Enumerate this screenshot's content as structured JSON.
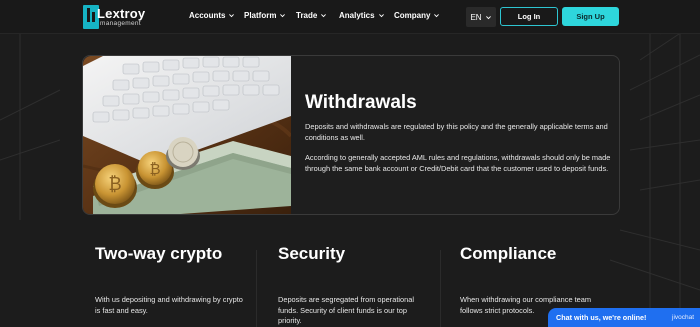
{
  "colors": {
    "accent": "#2ed6dc",
    "background": "#1c1c1c",
    "chat": "#1f6ff0"
  },
  "header": {
    "logo_name": "Lextroy",
    "logo_sub": "management",
    "nav": [
      {
        "label": "Accounts",
        "icon": "chevron-down-icon"
      },
      {
        "label": "Platform",
        "icon": "chevron-down-icon"
      },
      {
        "label": "Trade",
        "icon": "chevron-down-icon"
      },
      {
        "label": "Analytics",
        "icon": "chevron-down-icon"
      },
      {
        "label": "Company",
        "icon": "chevron-down-icon"
      }
    ],
    "language": "EN",
    "login_label": "Log In",
    "signup_label": "Sign Up"
  },
  "hero": {
    "title": "Withdrawals",
    "paragraph1": "Deposits and withdrawals are regulated by this policy and the generally applicable terms and conditions as well.",
    "paragraph2": "According to generally accepted AML rules and regulations, withdrawals should only be made through the same bank account or Credit/Debit card that the customer used to deposit funds."
  },
  "features": [
    {
      "title": "Two-way crypto",
      "text": "With us depositing and withdrawing by crypto is fast and easy."
    },
    {
      "title": "Security",
      "text": "Deposits are segregated from operational funds. Security of client funds is our top priority."
    },
    {
      "title": "Compliance",
      "text": "When withdrawing our compliance team follows strict protocols."
    }
  ],
  "chat": {
    "label": "Chat with us, we're online!",
    "brand": "jivochat"
  }
}
